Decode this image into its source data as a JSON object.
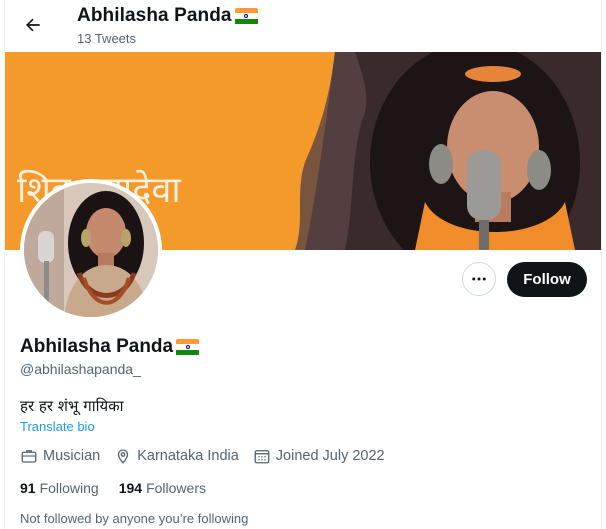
{
  "header": {
    "title": "Abhilasha Panda",
    "tweet_count": "13 Tweets"
  },
  "banner": {
    "text": "शिव महादेवा"
  },
  "actions": {
    "follow_label": "Follow"
  },
  "profile": {
    "name": "Abhilasha Panda",
    "handle": "@abhilashapanda_",
    "bio": "हर हर शंभू गायिका",
    "translate_label": "Translate bio"
  },
  "meta": {
    "category": "Musician",
    "location": "Karnataka India",
    "joined": "Joined July 2022"
  },
  "stats": {
    "following_count": "91",
    "following_label": "Following",
    "followers_count": "194",
    "followers_label": "Followers"
  },
  "footer": {
    "not_followed_text": "Not followed by anyone you’re following"
  },
  "colors": {
    "accent": "#1d9bf0",
    "banner_orange": "#f39a2b",
    "follow_button": "#0f1419",
    "secondary_text": "#536471"
  }
}
